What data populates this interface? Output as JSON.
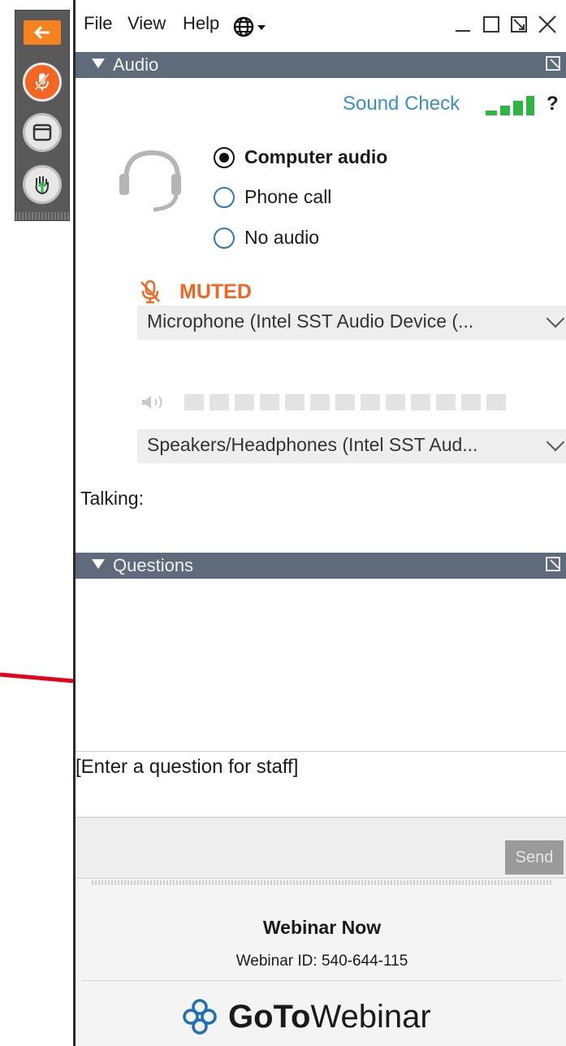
{
  "control_strip": {
    "arrow_icon": "left-arrow-icon",
    "mic_icon": "microphone-muted-icon",
    "window_icon": "window-icon",
    "hand_icon": "raise-hand-icon",
    "accent": "#f26522"
  },
  "menubar": {
    "items": [
      "File",
      "View",
      "Help"
    ],
    "language_icon": "globe-icon",
    "window_controls": [
      "minimize-icon",
      "maximize-icon",
      "popout-icon",
      "close-icon"
    ]
  },
  "audio": {
    "header": "Audio",
    "sound_check": "Sound Check",
    "help": "?",
    "options": [
      "Computer audio",
      "Phone call",
      "No audio"
    ],
    "selected": "Computer audio",
    "muted_label": "MUTED",
    "microphone": "Microphone (Intel SST Audio Device (...",
    "speakers": "Speakers/Headphones (Intel SST Aud...",
    "talking_label": "Talking:"
  },
  "questions": {
    "header": "Questions",
    "placeholder": "[Enter a question for staff]",
    "send_label": "Send"
  },
  "footer": {
    "title": "Webinar Now",
    "webinar_id": "Webinar ID: 540-644-115",
    "brand_bold": "GoTo",
    "brand_light": "Webinar"
  },
  "colors": {
    "header_bg": "#5f6b7a",
    "link": "#3a8fc7",
    "muted": "#f26522",
    "signal": "#2fb544"
  }
}
